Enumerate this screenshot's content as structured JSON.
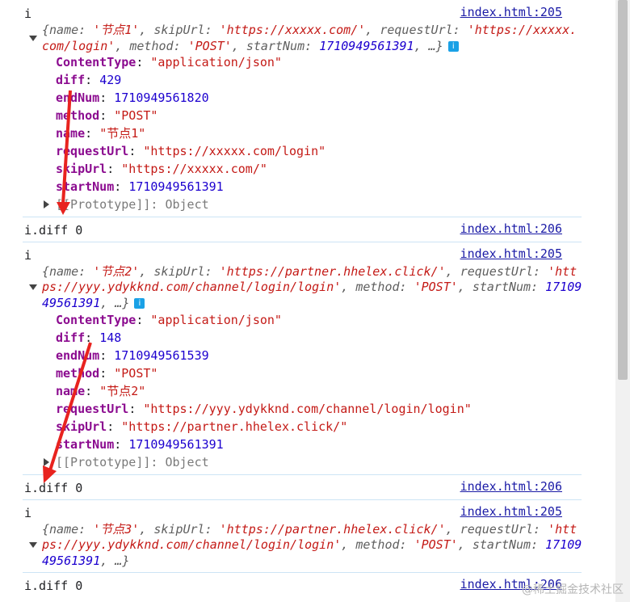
{
  "console": {
    "entries": [
      {
        "label": "i",
        "source": "index.html:205",
        "preview_lines": [
          "{name: '节点1', skipUrl: 'https://xxxxx.com/', requestUrl: 'https://xxxxx.",
          "com/login', method: 'POST', startNum: 1710949561391, …}"
        ],
        "props": [
          {
            "key": "ContentType",
            "value": "\"application/json\""
          },
          {
            "key": "diff",
            "value": "429"
          },
          {
            "key": "endNum",
            "value": "1710949561820"
          },
          {
            "key": "method",
            "value": "\"POST\""
          },
          {
            "key": "name",
            "value": "\"节点1\""
          },
          {
            "key": "requestUrl",
            "value": "\"https://xxxxx.com/login\""
          },
          {
            "key": "skipUrl",
            "value": "\"https://xxxxx.com/\""
          },
          {
            "key": "startNum",
            "value": "1710949561391"
          }
        ],
        "prototype": "[[Prototype]]: Object"
      },
      {
        "label": "i.diff 0",
        "source": "index.html:206"
      },
      {
        "label": "i",
        "source": "index.html:205",
        "preview_lines": [
          "{name: '节点2', skipUrl: 'https://partner.hhelex.click/', requestUrl: 'htt",
          "ps://yyy.ydykknd.com/channel/login/login', method: 'POST', startNum: 17109",
          "49561391, …}"
        ],
        "props": [
          {
            "key": "ContentType",
            "value": "\"application/json\""
          },
          {
            "key": "diff",
            "value": "148"
          },
          {
            "key": "endNum",
            "value": "1710949561539"
          },
          {
            "key": "method",
            "value": "\"POST\""
          },
          {
            "key": "name",
            "value": "\"节点2\""
          },
          {
            "key": "requestUrl",
            "value": "\"https://yyy.ydykknd.com/channel/login/login\""
          },
          {
            "key": "skipUrl",
            "value": "\"https://partner.hhelex.click/\""
          },
          {
            "key": "startNum",
            "value": "1710949561391"
          }
        ],
        "prototype": "[[Prototype]]: Object"
      },
      {
        "label": "i.diff 0",
        "source": "index.html:206"
      },
      {
        "label": "i",
        "source": "index.html:205",
        "preview_lines": [
          "{name: '节点3', skipUrl: 'https://partner.hhelex.click/', requestUrl: 'htt",
          "ps://yyy.ydykknd.com/channel/login/login', method: 'POST', startNum: 17109",
          "49561391, …}"
        ]
      },
      {
        "label": "i.diff 0",
        "source": "index.html:206"
      }
    ]
  },
  "watermark": "@稀土掘金技术社区",
  "colors": {
    "link": "#1a1aa6",
    "key": "#8b0a8f",
    "string": "#c41a16",
    "number": "#1c00cf",
    "arrow": "#e8231f"
  }
}
